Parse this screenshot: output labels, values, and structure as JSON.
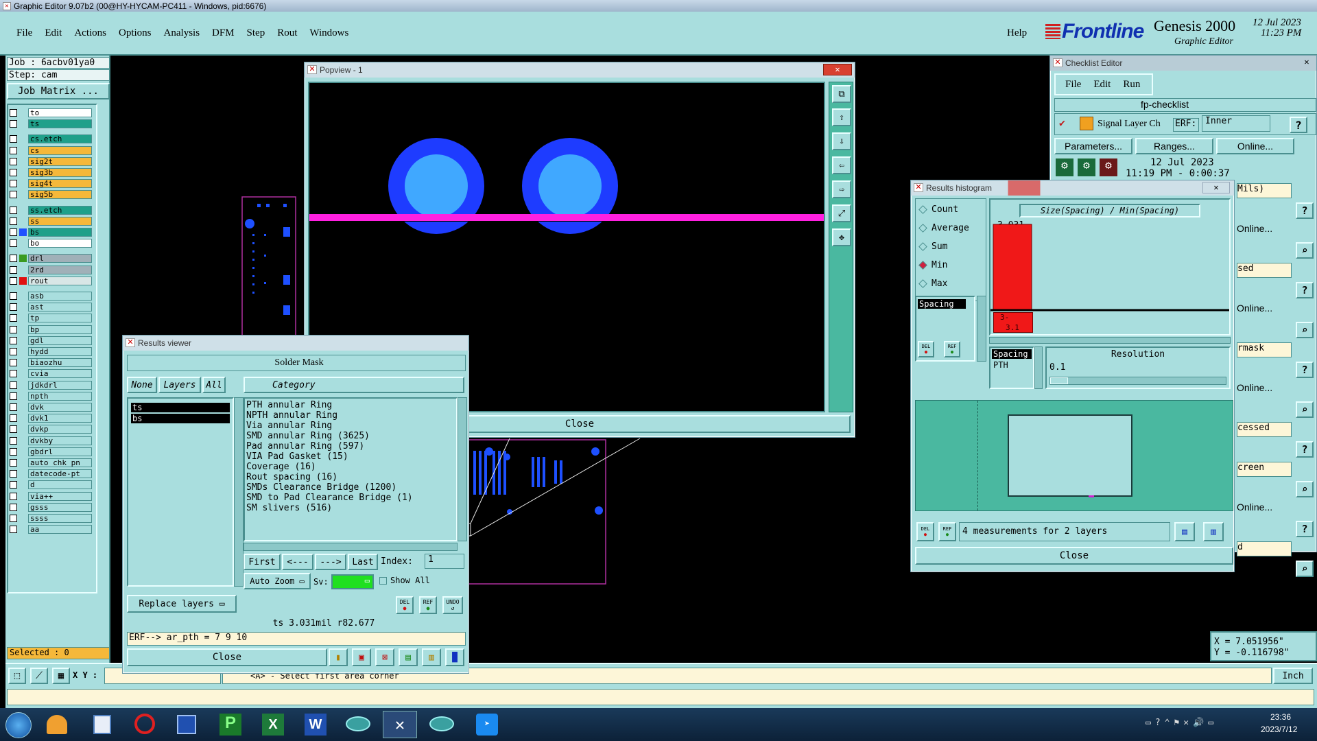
{
  "titlebar": {
    "title": "Graphic Editor 9.07b2 (00@HY-HYCAM-PC411 - Windows, pid:6676)"
  },
  "menubar": {
    "items": [
      "File",
      "Edit",
      "Actions",
      "Options",
      "Analysis",
      "DFM",
      "Step",
      "Rout",
      "Windows"
    ],
    "help": "Help"
  },
  "brand": {
    "logo": "Frontline",
    "product": "Genesis 2000",
    "sub": "Graphic Editor",
    "date": "12 Jul 2023",
    "time": "11:23 PM"
  },
  "left": {
    "job": "Job : 6acbv01ya0",
    "step": "Step: cam",
    "matrix": "Job Matrix ...",
    "layers": [
      {
        "name": "to",
        "color": "#ffffff",
        "sw": ""
      },
      {
        "name": "ts",
        "color": "#1fa08a",
        "sw": ""
      },
      {
        "name": "cs.etch",
        "color": "#1fa08a",
        "sw": ""
      },
      {
        "name": "cs",
        "color": "#f5b83a",
        "sw": ""
      },
      {
        "name": "sig2t",
        "color": "#f5b83a",
        "sw": ""
      },
      {
        "name": "sig3b",
        "color": "#f5b83a",
        "sw": ""
      },
      {
        "name": "sig4t",
        "color": "#f5b83a",
        "sw": ""
      },
      {
        "name": "sig5b",
        "color": "#f5b83a",
        "sw": ""
      },
      {
        "name": "ss.etch",
        "color": "#1fa08a",
        "sw": ""
      },
      {
        "name": "ss",
        "color": "#f5b83a",
        "sw": ""
      },
      {
        "name": "bs",
        "color": "#1fa08a",
        "sw": "#1e50ff"
      },
      {
        "name": "bo",
        "color": "#ffffff",
        "sw": ""
      },
      {
        "name": "drl",
        "color": "#a0b0b8",
        "sw": "#3a9a20"
      },
      {
        "name": "2rd",
        "color": "#a0b0b8",
        "sw": ""
      },
      {
        "name": "rout",
        "color": "#d8e6e6",
        "sw": "#e01010"
      },
      {
        "name": "asb",
        "color": "#a9dede",
        "sw": ""
      },
      {
        "name": "ast",
        "color": "#a9dede",
        "sw": ""
      },
      {
        "name": "tp",
        "color": "#a9dede",
        "sw": ""
      },
      {
        "name": "bp",
        "color": "#a9dede",
        "sw": ""
      },
      {
        "name": "gdl",
        "color": "#a9dede",
        "sw": ""
      },
      {
        "name": "hydd",
        "color": "#a9dede",
        "sw": ""
      },
      {
        "name": "biaozhu",
        "color": "#a9dede",
        "sw": ""
      },
      {
        "name": "cvia",
        "color": "#a9dede",
        "sw": ""
      },
      {
        "name": "jdkdrl",
        "color": "#a9dede",
        "sw": ""
      },
      {
        "name": "npth",
        "color": "#a9dede",
        "sw": ""
      },
      {
        "name": "dvk",
        "color": "#a9dede",
        "sw": ""
      },
      {
        "name": "dvk1",
        "color": "#a9dede",
        "sw": ""
      },
      {
        "name": "dvkp",
        "color": "#a9dede",
        "sw": ""
      },
      {
        "name": "dvkby",
        "color": "#a9dede",
        "sw": ""
      },
      {
        "name": "gbdrl",
        "color": "#a9dede",
        "sw": ""
      },
      {
        "name": "auto_chk_pn",
        "color": "#a9dede",
        "sw": ""
      },
      {
        "name": "datecode-pt",
        "color": "#a9dede",
        "sw": ""
      },
      {
        "name": "d",
        "color": "#a9dede",
        "sw": ""
      },
      {
        "name": "via++",
        "color": "#a9dede",
        "sw": ""
      },
      {
        "name": "gsss",
        "color": "#a9dede",
        "sw": ""
      },
      {
        "name": "ssss",
        "color": "#a9dede",
        "sw": ""
      },
      {
        "name": "aa",
        "color": "#a9dede",
        "sw": ""
      }
    ],
    "selected": "Selected : 0"
  },
  "bottombar": {
    "xy_label": "X Y :",
    "prompt": "<A> - Select first area corner",
    "units": "Inch"
  },
  "popview": {
    "title": "Popview - 1",
    "close": "Close"
  },
  "results": {
    "title": "Results viewer",
    "header": "Solder Mask",
    "none": "None",
    "layers": "Layers",
    "all": "All",
    "category_hdr": "Category",
    "layer_items": [
      "ts",
      "bs"
    ],
    "categories": [
      "PTH annular Ring",
      "NPTH annular Ring",
      "Via annular Ring",
      "SMD annular Ring (3625)",
      "Pad annular Ring (597)",
      "VIA Pad Gasket (15)",
      "Coverage (16)",
      "Rout spacing (16)",
      "SMDs Clearance Bridge (1200)",
      "SMD to Pad Clearance Bridge (1)",
      "SM slivers (516)"
    ],
    "nav": {
      "first": "First",
      "prev": "<---",
      "next": "--->",
      "last": "Last",
      "index_label": "Index:",
      "index_value": "1"
    },
    "autozoom": "Auto Zoom",
    "sv": "Sv:",
    "showall": "Show All",
    "replace": "Replace layers",
    "del": "DEL",
    "ref": "REF",
    "undo": "UNDO",
    "status": "ts 3.031mil   r82.677",
    "erf": "ERF--> ar_pth = 7 9 10",
    "close": "Close"
  },
  "checklist": {
    "title": "Checklist Editor",
    "menu": [
      "File",
      "Edit",
      "Run"
    ],
    "name": "fp-checklist",
    "row1_label": "Signal Layer Ch",
    "erf_label": "ERF:",
    "erf_value": "Inner",
    "params": "Parameters...",
    "ranges": "Ranges...",
    "online": "Online...",
    "date": "12 Jul 2023",
    "time": "11:19 PM - 0:00:37",
    "side_texts": [
      "Mils)",
      "Online...",
      "sed",
      "Online...",
      "rmask",
      "Online...",
      "cessed",
      "creen",
      "Online...",
      "d"
    ]
  },
  "histogram": {
    "title": "Results histogram",
    "modes": [
      "Count",
      "Average",
      "Sum",
      "Min",
      "Max"
    ],
    "selected_mode": "Min",
    "category": "Spacing",
    "chart_title": "Size(Spacing) / Min(Spacing)",
    "bar_value": "3.031",
    "range_label": "3-",
    "range_label2": "3.1",
    "list2": [
      "Spacing",
      "PTH"
    ],
    "resolution_label": "Resolution",
    "resolution_value": "0.1",
    "measurements": "4 measurements for 2 layers",
    "close": "Close",
    "del": "DEL",
    "ref": "REF",
    "chart_data": {
      "type": "bar",
      "title": "Size(Spacing) / Min(Spacing)",
      "categories": [
        "3- 3.1"
      ],
      "values": [
        3.031
      ]
    }
  },
  "coords": {
    "x": "X = 7.051956\"",
    "y": "Y = -0.116798\""
  },
  "taskbar": {
    "time": "23:36",
    "date": "2023/7/12"
  }
}
